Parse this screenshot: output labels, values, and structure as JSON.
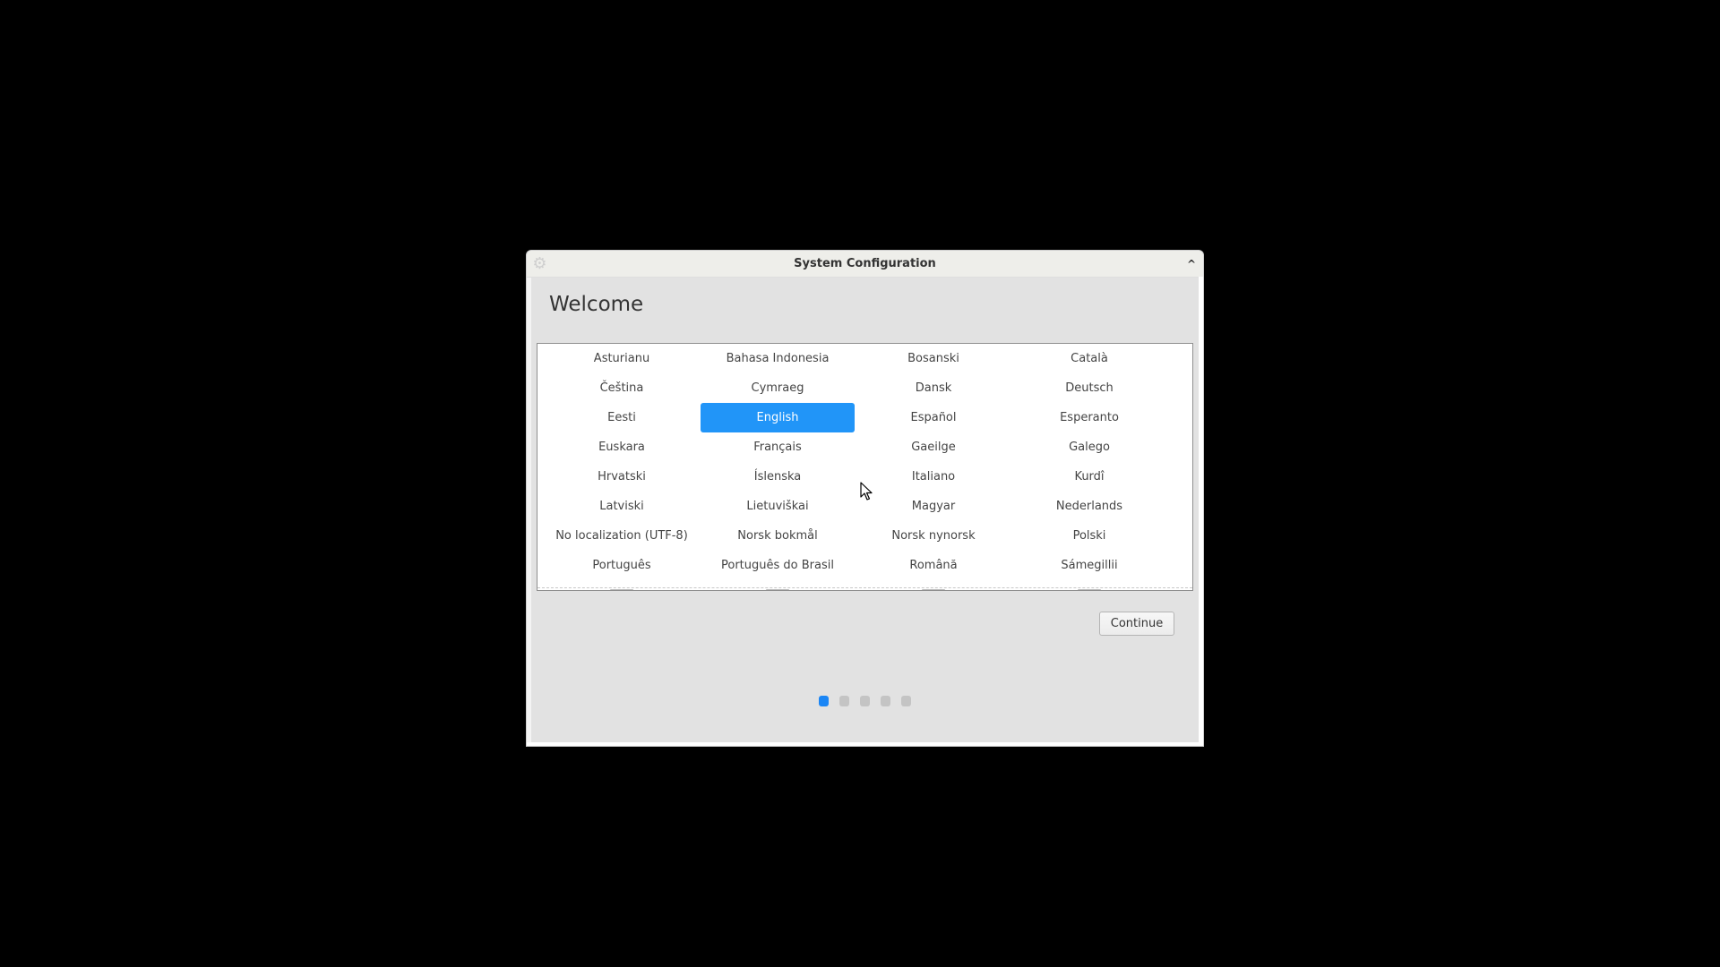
{
  "window": {
    "title": "System Configuration",
    "icon": "gear-icon",
    "collapse_glyph": "^",
    "heading": "Welcome"
  },
  "language_list": {
    "items": [
      "Asturianu",
      "Bahasa Indonesia",
      "Bosanski",
      "Català",
      "Čeština",
      "Cymraeg",
      "Dansk",
      "Deutsch",
      "Eesti",
      "English",
      "Español",
      "Esperanto",
      "Euskara",
      "Français",
      "Gaeilge",
      "Galego",
      "Hrvatski",
      "Íslenska",
      "Italiano",
      "Kurdî",
      "Latviski",
      "Lietuviškai",
      "Magyar",
      "Nederlands",
      "No localization (UTF-8)",
      "Norsk bokmål",
      "Norsk nynorsk",
      "Polski",
      "Português",
      "Português do Brasil",
      "Română",
      "Sámegillii"
    ],
    "selected": "English",
    "selected_color": "#2195f8"
  },
  "buttons": {
    "continue": "Continue"
  },
  "pager": {
    "total_steps": 5,
    "current_step": 1,
    "active_color": "#1b86f5"
  }
}
